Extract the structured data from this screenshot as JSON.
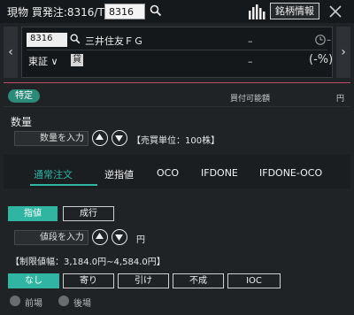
{
  "header": {
    "title": "現物 買発注:8316/T",
    "code_value": "8316",
    "meigara_label": "銘柄情報"
  },
  "stock": {
    "code": "8316",
    "name": "三井住友ＦＧ",
    "price": "–",
    "time_dash": "–",
    "market": "東証 ∨",
    "lending_badge": "貸",
    "change": "–",
    "change_pct": "(-%)"
  },
  "account": {
    "badge": "特定",
    "buying_power_label": "買付可能額",
    "buying_power_unit": "円"
  },
  "quantity": {
    "label": "数量",
    "placeholder": "数量を入力",
    "unit_note": "【売買単位：100株】"
  },
  "tabs": [
    "通常注文",
    "逆指値",
    "OCO",
    "IFDONE",
    "IFDONE-OCO"
  ],
  "order_type": {
    "limit_label": "指値",
    "market_label": "成行"
  },
  "price": {
    "placeholder": "値段を入力",
    "unit": "円",
    "limit_range": "【制限値幅：3,184.0円∼4,584.0円】"
  },
  "conditions": [
    "なし",
    "寄り",
    "引け",
    "不成",
    "IOC"
  ],
  "session": [
    "前場",
    "後場"
  ],
  "colors": {
    "accent": "#2fb5a1",
    "divider_red": "#c0506a",
    "background": "#1f2326"
  }
}
